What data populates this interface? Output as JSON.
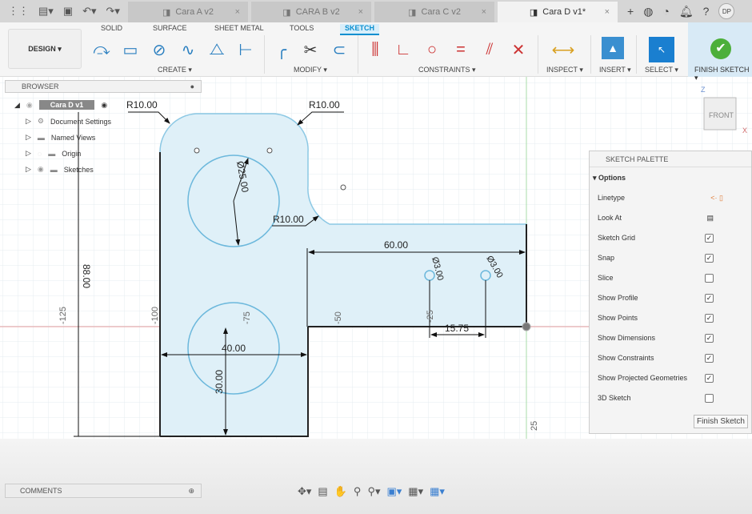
{
  "topbar": {
    "tabs": [
      {
        "label": "Cara A v2",
        "active": false
      },
      {
        "label": "CARA B v2",
        "active": false
      },
      {
        "label": "Cara C v2",
        "active": false
      },
      {
        "label": "Cara D v1*",
        "active": true
      }
    ],
    "user_initials": "DP"
  },
  "ribbon": {
    "workspace": "DESIGN ▾",
    "tabs": [
      "SOLID",
      "SURFACE",
      "SHEET METAL",
      "TOOLS",
      "SKETCH"
    ],
    "active_tab": "SKETCH",
    "groups": {
      "create": "CREATE ▾",
      "modify": "MODIFY ▾",
      "constraints": "CONSTRAINTS ▾",
      "inspect": "INSPECT ▾",
      "insert": "INSERT ▾",
      "select": "SELECT ▾",
      "finish": "FINISH SKETCH ▾"
    }
  },
  "browser": {
    "title": "BROWSER",
    "root": "Cara D v1",
    "items": [
      "Document Settings",
      "Named Views",
      "Origin",
      "Sketches"
    ]
  },
  "palette": {
    "title": "SKETCH PALETTE",
    "section": "Options",
    "rows": [
      {
        "label": "Linetype",
        "type": "icon"
      },
      {
        "label": "Look At",
        "type": "icon"
      },
      {
        "label": "Sketch Grid",
        "checked": true
      },
      {
        "label": "Snap",
        "checked": true
      },
      {
        "label": "Slice",
        "checked": false
      },
      {
        "label": "Show Profile",
        "checked": true
      },
      {
        "label": "Show Points",
        "checked": true
      },
      {
        "label": "Show Dimensions",
        "checked": true
      },
      {
        "label": "Show Constraints",
        "checked": true
      },
      {
        "label": "Show Projected Geometries",
        "checked": true
      },
      {
        "label": "3D Sketch",
        "checked": false
      }
    ],
    "finish_button": "Finish Sketch"
  },
  "comments": {
    "title": "COMMENTS"
  },
  "viewcube": {
    "label": "FRONT",
    "axis_x": "X",
    "axis_z": "Z"
  },
  "sketch": {
    "dims": {
      "r_top_left": "R10.00",
      "r_top_right": "R10.00",
      "r_fillet": "R10.00",
      "dia_big": "Ø25.00",
      "len_60": "60.00",
      "dia_small_1": "Ø3.00",
      "dia_small_2": "Ø3.00",
      "len_15": "15.75",
      "len_40": "40.00",
      "len_30": "30.00",
      "len_88": "88.00"
    },
    "ruler": [
      "-125",
      "-100",
      "-75",
      "-50",
      "-25",
      "25"
    ]
  },
  "colors": {
    "accent": "#0a8fd0",
    "profile_fill": "#dff0f8",
    "profile_edge": "#7fc3e0",
    "x_axis": "#e08080",
    "y_axis": "#90d090"
  }
}
